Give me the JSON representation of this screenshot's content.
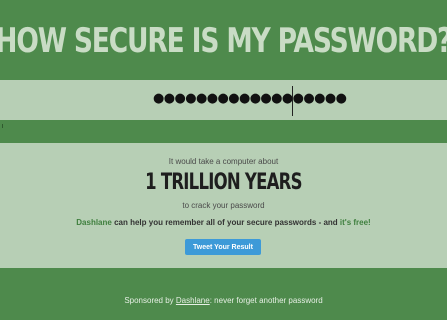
{
  "header": {
    "title": "HOW SECURE IS MY PASSWORD?"
  },
  "password": {
    "masked_value": "●●●●●●●●●●●●●●●●●●"
  },
  "result": {
    "lead": "It would take a computer about",
    "time": "1 TRILLION YEARS",
    "sub": "to crack your password",
    "promo_brand": "Dashlane",
    "promo_middle": " can help you remember all of your secure passwords - and ",
    "promo_free": "it's free!",
    "tweet_button": "Tweet Your Result"
  },
  "footer": {
    "prefix": "Sponsored by ",
    "link": "Dashlane",
    "suffix": ": never forget another password"
  },
  "colors": {
    "background_green": "#4e8a4c",
    "band_light_green": "#b7cfb5",
    "title_color": "#c9dcc5",
    "accent_green": "#3f7f3e",
    "tweet_blue": "#3d9ad8"
  }
}
